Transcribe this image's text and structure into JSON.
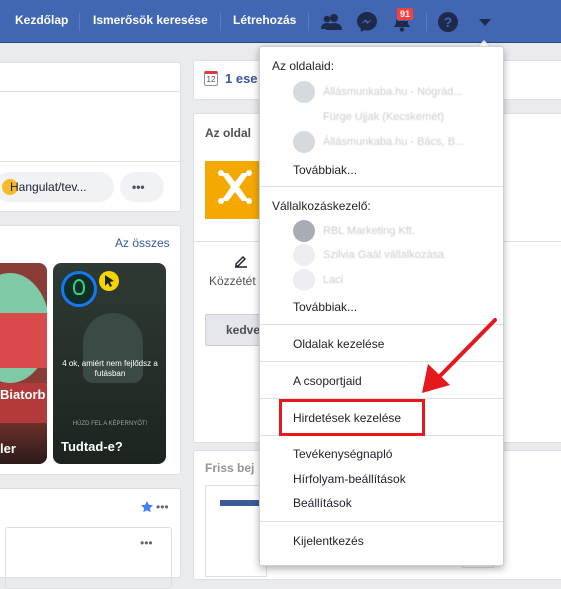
{
  "topbar": {
    "home": "Kezdőlap",
    "find_friends": "Ismerősök keresése",
    "create": "Létrehozás",
    "notifications_count": "91",
    "bg_color": "#4267b2"
  },
  "left": {
    "mood_label": "Hangulat/tev...",
    "more_label": "•••",
    "see_all": "Az összes",
    "story1_title": "Biatorb",
    "story1_caption": "ler",
    "story2_text": "4 ok, amiért nem fejlődsz a futásban",
    "story2_title": "Tudtad-e?",
    "story2_footer": "HÚZD FEL A KÉPERNYŐT!",
    "post_more": "•••",
    "post_more2": "•••"
  },
  "right": {
    "calendar_day": "12",
    "events_text": "1 ese",
    "pages_title": "Az oldal",
    "publish": "Közzétét",
    "like_button": "kedve",
    "fresh": "Friss bej"
  },
  "menu": {
    "pages_header": "Az oldalaid:",
    "pages": [
      {
        "name": "Állásmunkaba.hu - Nógrád..."
      },
      {
        "name": "Fürge Ujjak (Kecskemét)"
      },
      {
        "name": "Állásmunkaba.hu - Bács, B..."
      }
    ],
    "pages_more": "Továbbiak...",
    "business_header": "Vállalkozáskezelő:",
    "business": [
      {
        "name": "RBL Marketing Kft."
      },
      {
        "name": "Szilvia Gaál vállalkozása"
      },
      {
        "name": "Laci"
      }
    ],
    "business_more": "Továbbiak...",
    "manage_pages": "Oldalak kezelése",
    "groups": "A csoportjaid",
    "manage_ads": "Hirdetések kezelése",
    "activity_log": "Tevékenységnapló",
    "news_feed_prefs": "Hírfolyam-beállítások",
    "settings": "Beállítások",
    "logout": "Kijelentkezés"
  },
  "annotation": {
    "color": "#e5181e"
  }
}
